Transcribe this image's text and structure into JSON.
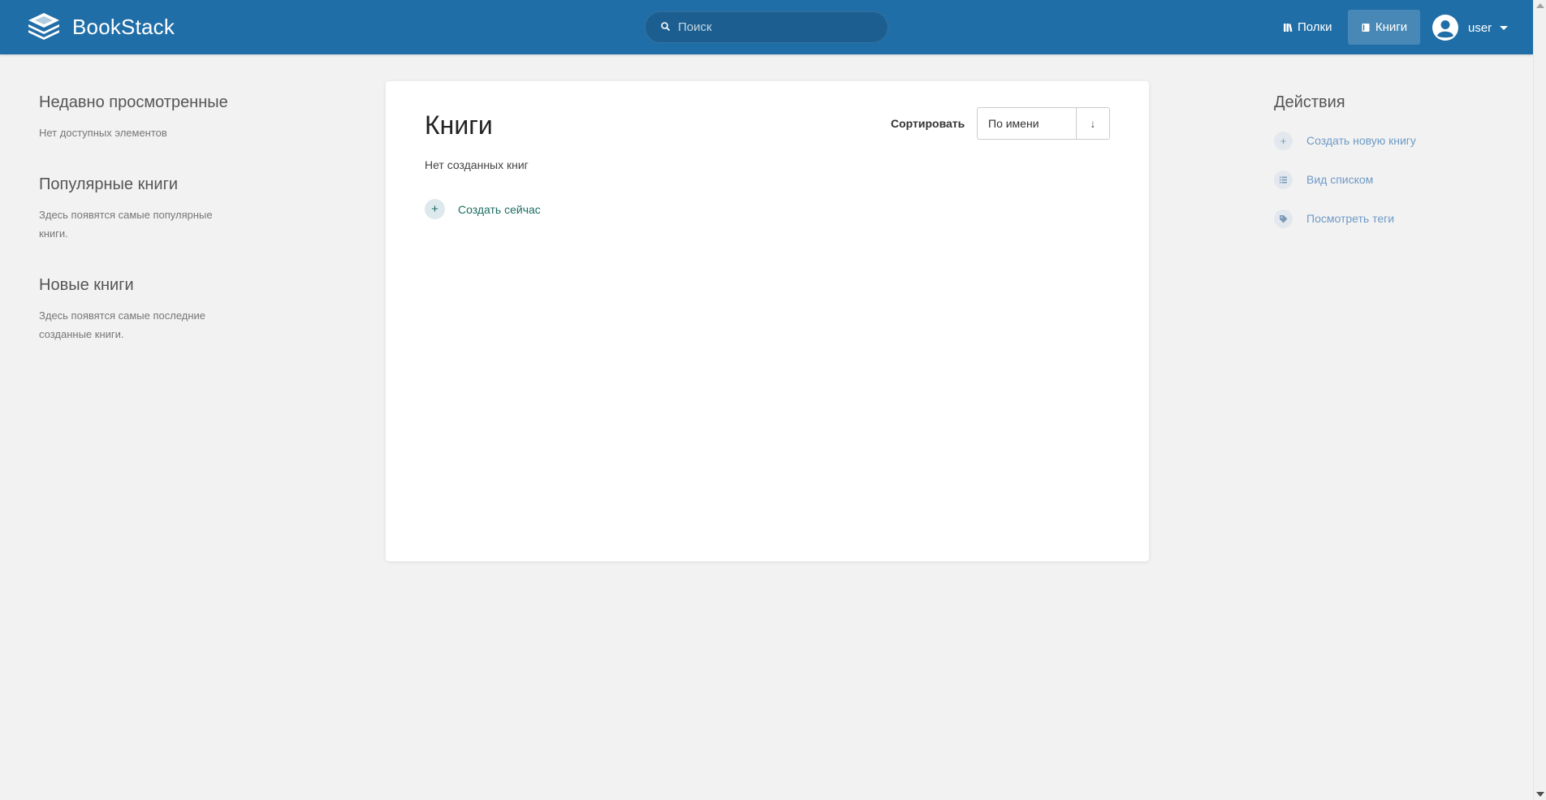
{
  "header": {
    "logo_text": "BookStack",
    "search_placeholder": "Поиск",
    "nav": [
      {
        "label": "Полки",
        "icon": "shelves-icon"
      },
      {
        "label": "Книги",
        "icon": "book-icon",
        "active": true
      }
    ],
    "user_name": "user",
    "brand_color": "#206ea7"
  },
  "left": {
    "recent": {
      "title": "Недавно просмотренные",
      "text": "Нет доступных элементов"
    },
    "popular": {
      "title": "Популярные книги",
      "text": "Здесь появятся самые популярные книги."
    },
    "new": {
      "title": "Новые книги",
      "text": "Здесь появятся самые последние созданные книги."
    }
  },
  "main": {
    "title": "Книги",
    "sort_label": "Сортировать",
    "sort_value": "По имени",
    "sort_direction_icon": "arrow-down-icon",
    "empty_text": "Нет созданных книг",
    "create_now": "Создать сейчас"
  },
  "right": {
    "title": "Действия",
    "actions": [
      {
        "label": "Создать новую книгу",
        "icon": "plus-icon"
      },
      {
        "label": "Вид списком",
        "icon": "list-icon"
      },
      {
        "label": "Посмотреть теги",
        "icon": "tag-icon"
      }
    ]
  }
}
